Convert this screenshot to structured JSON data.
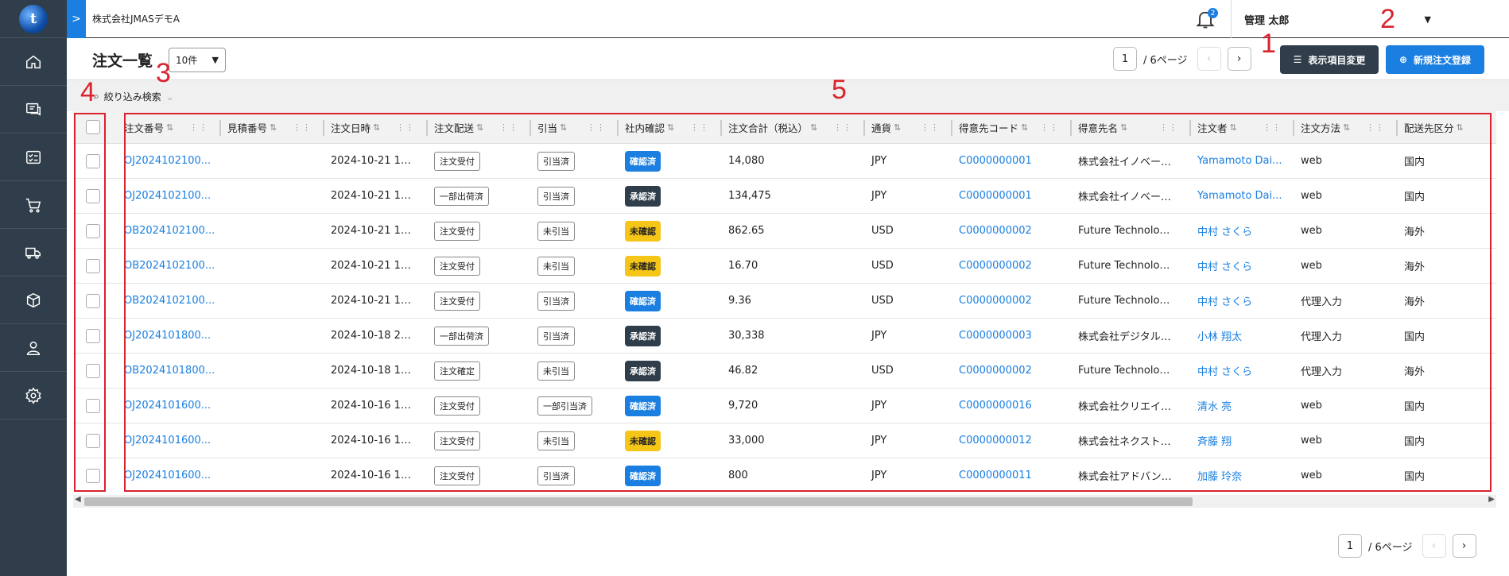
{
  "app": {
    "logo_letter": "t",
    "company": "株式会社JMASデモA",
    "notification_count": "2",
    "user_name": "管理 太郎"
  },
  "sidebar": {
    "items": [
      {
        "icon": "home-icon"
      },
      {
        "icon": "chat-document-icon"
      },
      {
        "icon": "checklist-icon"
      },
      {
        "icon": "cart-icon"
      },
      {
        "icon": "truck-icon"
      },
      {
        "icon": "package-icon"
      },
      {
        "icon": "user-icon"
      },
      {
        "icon": "gear-icon"
      }
    ]
  },
  "toolbar": {
    "title": "注文一覧",
    "page_size": "10件",
    "page_current": "1",
    "page_total_label": "/ 6ページ",
    "column_settings_label": "表示項目変更",
    "new_order_label": "新規注文登録",
    "filter_label": "絞り込み検索"
  },
  "annotations": [
    "1",
    "2",
    "3",
    "4",
    "5"
  ],
  "table": {
    "headers": [
      "注文番号",
      "見積番号",
      "注文日時",
      "注文配送",
      "引当",
      "社内確認",
      "注文合計（税込）",
      "通貨",
      "得意先コード",
      "得意先名",
      "注文者",
      "注文方法",
      "配送先区分"
    ],
    "rows": [
      {
        "order_no": "OJ2024102100...",
        "quote_no": "",
        "date": "2024-10-21 1…",
        "delivery": "注文受付",
        "alloc": "引当済",
        "confirm": "確認済",
        "confirm_type": "blue",
        "total": "14,080",
        "currency": "JPY",
        "cust_code": "C0000000001",
        "cust_name": "株式会社イノベー…",
        "orderer": "Yamamoto Dai...",
        "method": "web",
        "ship": "国内"
      },
      {
        "order_no": "OJ2024102100...",
        "quote_no": "",
        "date": "2024-10-21 1…",
        "delivery": "一部出荷済",
        "alloc": "引当済",
        "confirm": "承認済",
        "confirm_type": "dark",
        "total": "134,475",
        "currency": "JPY",
        "cust_code": "C0000000001",
        "cust_name": "株式会社イノベー…",
        "orderer": "Yamamoto Dai...",
        "method": "web",
        "ship": "国内"
      },
      {
        "order_no": "OB2024102100...",
        "quote_no": "",
        "date": "2024-10-21 1…",
        "delivery": "注文受付",
        "alloc": "未引当",
        "confirm": "未確認",
        "confirm_type": "yellow",
        "total": "862.65",
        "currency": "USD",
        "cust_code": "C0000000002",
        "cust_name": "Future Technolo…",
        "orderer": "中村 さくら",
        "method": "web",
        "ship": "海外"
      },
      {
        "order_no": "OB2024102100...",
        "quote_no": "",
        "date": "2024-10-21 1…",
        "delivery": "注文受付",
        "alloc": "未引当",
        "confirm": "未確認",
        "confirm_type": "yellow",
        "total": "16.70",
        "currency": "USD",
        "cust_code": "C0000000002",
        "cust_name": "Future Technolo…",
        "orderer": "中村 さくら",
        "method": "web",
        "ship": "海外"
      },
      {
        "order_no": "OB2024102100...",
        "quote_no": "",
        "date": "2024-10-21 1…",
        "delivery": "注文受付",
        "alloc": "引当済",
        "confirm": "確認済",
        "confirm_type": "blue",
        "total": "9.36",
        "currency": "USD",
        "cust_code": "C0000000002",
        "cust_name": "Future Technolo…",
        "orderer": "中村 さくら",
        "method": "代理入力",
        "ship": "海外"
      },
      {
        "order_no": "OJ2024101800...",
        "quote_no": "",
        "date": "2024-10-18 2…",
        "delivery": "一部出荷済",
        "alloc": "引当済",
        "confirm": "承認済",
        "confirm_type": "dark",
        "total": "30,338",
        "currency": "JPY",
        "cust_code": "C0000000003",
        "cust_name": "株式会社デジタル…",
        "orderer": "小林 翔太",
        "method": "代理入力",
        "ship": "国内"
      },
      {
        "order_no": "OB2024101800...",
        "quote_no": "",
        "date": "2024-10-18 1…",
        "delivery": "注文確定",
        "alloc": "未引当",
        "confirm": "承認済",
        "confirm_type": "dark",
        "total": "46.82",
        "currency": "USD",
        "cust_code": "C0000000002",
        "cust_name": "Future Technolo…",
        "orderer": "中村 さくら",
        "method": "代理入力",
        "ship": "海外"
      },
      {
        "order_no": "OJ2024101600...",
        "quote_no": "",
        "date": "2024-10-16 1…",
        "delivery": "注文受付",
        "alloc": "一部引当済",
        "confirm": "確認済",
        "confirm_type": "blue",
        "total": "9,720",
        "currency": "JPY",
        "cust_code": "C0000000016",
        "cust_name": "株式会社クリエイ…",
        "orderer": "清水 亮",
        "method": "web",
        "ship": "国内"
      },
      {
        "order_no": "OJ2024101600...",
        "quote_no": "",
        "date": "2024-10-16 1…",
        "delivery": "注文受付",
        "alloc": "未引当",
        "confirm": "未確認",
        "confirm_type": "yellow",
        "total": "33,000",
        "currency": "JPY",
        "cust_code": "C0000000012",
        "cust_name": "株式会社ネクスト…",
        "orderer": "斉藤 翔",
        "method": "web",
        "ship": "国内"
      },
      {
        "order_no": "OJ2024101600...",
        "quote_no": "",
        "date": "2024-10-16 1…",
        "delivery": "注文受付",
        "alloc": "引当済",
        "confirm": "確認済",
        "confirm_type": "blue",
        "total": "800",
        "currency": "JPY",
        "cust_code": "C0000000011",
        "cust_name": "株式会社アドバン…",
        "orderer": "加藤 玲奈",
        "method": "web",
        "ship": "国内"
      }
    ]
  },
  "footer": {
    "page_current": "1",
    "page_total_label": "/ 6ページ"
  },
  "colors": {
    "accent": "#1a7fe0",
    "sidebar": "#2f3e4a",
    "annotation": "#d9232e",
    "status_yellow": "#f5c518"
  }
}
